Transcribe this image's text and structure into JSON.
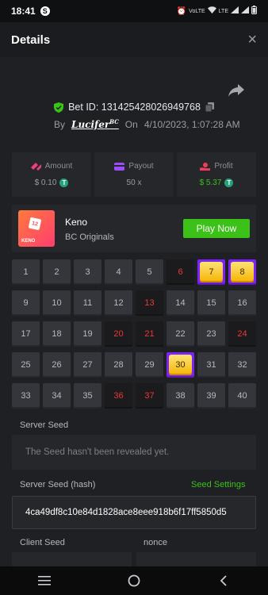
{
  "status_bar": {
    "time": "18:41",
    "notification_badge": "S",
    "signal_labels": [
      "VoLTE",
      "LTE"
    ]
  },
  "header": {
    "title": "Details",
    "close_label": "×"
  },
  "bet": {
    "bet_id_label": "Bet ID: 131425428026949768",
    "by_label": "By",
    "username": "Lucifer",
    "username_badge": "BC",
    "on_label": "On",
    "date": "4/10/2023, 1:07:28 AM"
  },
  "stats": {
    "amount_label": "Amount",
    "amount_value": "$ 0.10",
    "payout_label": "Payout",
    "payout_value": "50 x",
    "profit_label": "Profit",
    "profit_value": "$ 5.37",
    "coin_symbol": "T",
    "profit_color": "#3bc117"
  },
  "game": {
    "thumb_number": "12",
    "thumb_text": "KENO",
    "name": "Keno",
    "provider": "BC Originals",
    "play_label": "Play Now",
    "play_color": "#3bc117"
  },
  "keno_grid": {
    "numbers": [
      "1",
      "2",
      "3",
      "4",
      "5",
      "6",
      "7",
      "8",
      "9",
      "10",
      "11",
      "12",
      "13",
      "14",
      "15",
      "16",
      "17",
      "18",
      "19",
      "20",
      "21",
      "22",
      "23",
      "24",
      "25",
      "26",
      "27",
      "28",
      "29",
      "30",
      "31",
      "32",
      "33",
      "34",
      "35",
      "36",
      "37",
      "38",
      "39",
      "40"
    ],
    "states": [
      "normal",
      "normal",
      "normal",
      "normal",
      "normal",
      "miss",
      "hit",
      "hit",
      "normal",
      "normal",
      "normal",
      "normal",
      "miss",
      "normal",
      "normal",
      "normal",
      "normal",
      "normal",
      "normal",
      "miss",
      "miss",
      "normal",
      "normal",
      "miss",
      "normal",
      "normal",
      "normal",
      "normal",
      "normal",
      "hit",
      "normal",
      "normal",
      "normal",
      "normal",
      "normal",
      "miss",
      "miss",
      "normal",
      "normal",
      "normal"
    ],
    "hit_color": "#7d23f5",
    "miss_color": "#ea3838"
  },
  "server_seed": {
    "label": "Server Seed",
    "value": "The Seed hasn't been revealed yet."
  },
  "server_seed_hash": {
    "label": "Server Seed (hash)",
    "settings_label": "Seed Settings",
    "value": "4ca49df8c10e84d1828ace8eee918b6f17ff5850d5"
  },
  "client_seed": {
    "label": "Client Seed",
    "nonce_label": "nonce"
  }
}
